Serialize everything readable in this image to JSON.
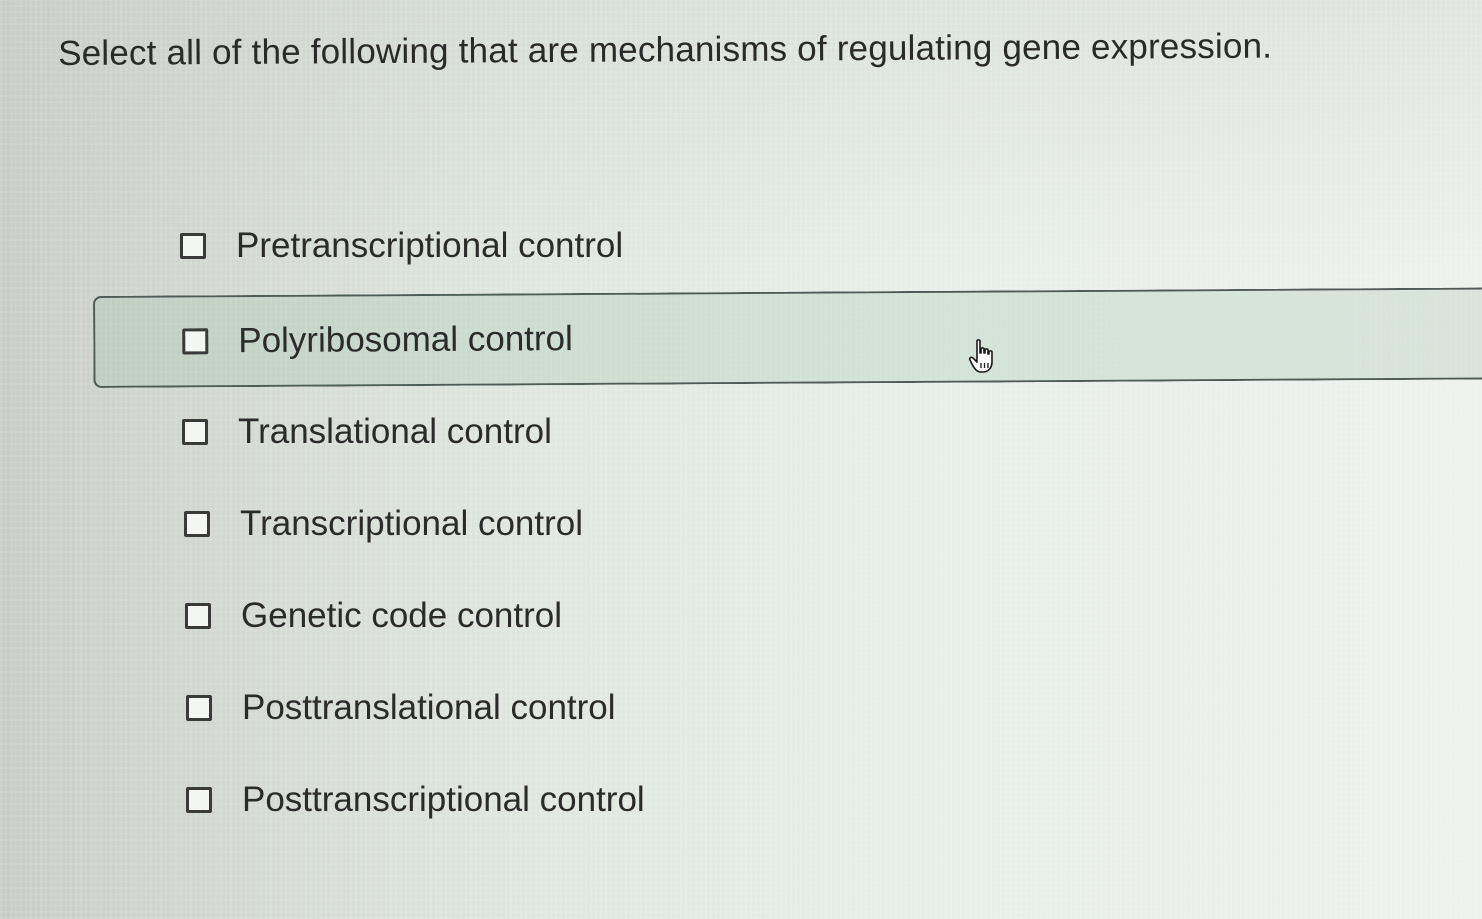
{
  "question": {
    "text": "Select all of the following that are mechanisms of regulating gene expression."
  },
  "options": [
    {
      "label": "Pretranscriptional control",
      "checked": false
    },
    {
      "label": "Polyribosomal control",
      "checked": false,
      "hovered": true
    },
    {
      "label": "Translational control",
      "checked": false
    },
    {
      "label": "Transcriptional control",
      "checked": false
    },
    {
      "label": "Genetic code control",
      "checked": false
    },
    {
      "label": "Posttranslational control",
      "checked": false
    },
    {
      "label": "Posttranscriptional control",
      "checked": false
    }
  ],
  "cursor": {
    "icon": "hand-pointer-icon"
  }
}
